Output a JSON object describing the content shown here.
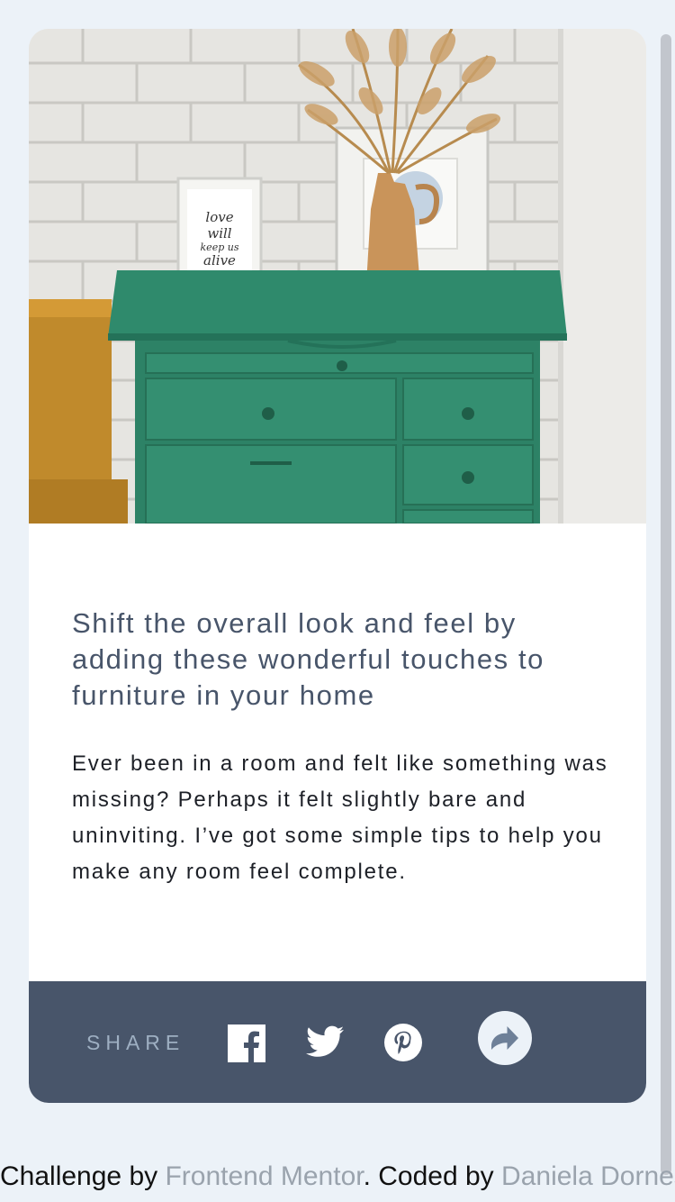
{
  "article": {
    "image_alt": "Green dresser with framed prints and a vase of dried grass",
    "frame_text": "love will keep us alive",
    "title": "Shift the overall look and feel by adding these wonderful touches to furniture in your home",
    "description": "Ever been in a room and felt like something was missing? Perhaps it felt slightly bare and uninviting. I’ve got some simple tips to help you make any room feel complete."
  },
  "share": {
    "label": "SHARE",
    "icons": [
      "facebook-icon",
      "twitter-icon",
      "pinterest-icon",
      "share-arrow-icon"
    ]
  },
  "footer": {
    "prefix": "Challenge by ",
    "link1": "Frontend Mentor",
    "middle": ". Coded by ",
    "link2": "Daniela Dornes"
  },
  "colors": {
    "background": "#ecf2f8",
    "share_bar": "#48556a",
    "title": "#48556a",
    "dresser": "#2f8a6c"
  }
}
